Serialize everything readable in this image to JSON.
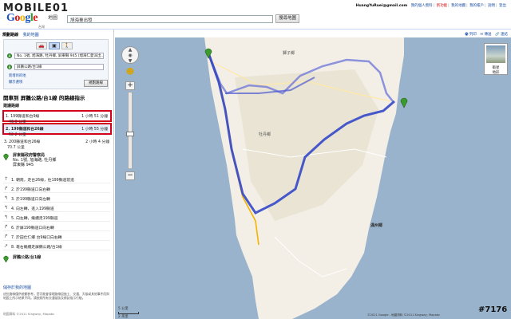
{
  "site": {
    "logo": "MOBILE01"
  },
  "toplinks": {
    "user": "HuangYuRuei@gmail.com",
    "items": [
      "我的個人資料",
      "新功能",
      "我的地圖",
      "我的帳戶",
      "說明",
      "登出"
    ]
  },
  "google": {
    "logo": "Google",
    "product": "地圖",
    "region": "台灣"
  },
  "search": {
    "value": "旭海臺出發",
    "button": "搜尋地圖"
  },
  "map_tools": {
    "items": [
      "列印",
      "傳送",
      "連結"
    ]
  },
  "sidebar": {
    "tabs": {
      "active": "規劃路線",
      "link": "我的地圖"
    },
    "start": {
      "marker": "A",
      "value": "No. 1號, 旭海路, 牡丹鄉, 屏東縣 945 (旭海仁愛派出…"
    },
    "end": {
      "marker": "B",
      "value": "屏鵝公路/台1線"
    },
    "add_destination": "新增目的地",
    "options": "顯示選項",
    "get_directions": "規劃路線",
    "heading": "開車到 屏鵝公路/台1線 的路線指示",
    "suggest_label": "建議路線",
    "routes": [
      {
        "name": "1. 199縣道和台9線",
        "time": "1 小時 51 分鐘",
        "dist": "46.0 公里"
      },
      {
        "name": "2. 199縣道和台26線",
        "time": "1 小時 55 分鐘",
        "dist": "52.2 公里"
      },
      {
        "name": "3. 200縣道和台26線",
        "time": "2 小時 4 分鐘",
        "dist": "70.7 公里"
      }
    ],
    "origin": {
      "title": "屏東縣政府警察局",
      "line2": "No. 1號, 旭海路, 牡丹鄉",
      "line3": "屏東縣 945"
    },
    "steps": [
      {
        "text": "1. 朝南，走台26線，往199縣道前進",
        "dist": ""
      },
      {
        "text": "2. 於199縣道口向右轉",
        "dist": ""
      },
      {
        "text": "3. 於199縣道口向左轉",
        "dist": ""
      },
      {
        "text": "4. 向左轉，進入199縣道",
        "dist": ""
      },
      {
        "text": "5. 向左轉，繼續走199縣道",
        "dist": ""
      },
      {
        "text": "6. 於屏199縣道口向右轉",
        "dist": ""
      },
      {
        "text": "7. 於田仕仁鄉 台9線口向右轉",
        "dist": ""
      },
      {
        "text": "8. 靠右繼續走屏鵝公路/台1線",
        "dist": ""
      }
    ],
    "destination": {
      "title": "屏鵝公路/台1線"
    },
    "save_link": "儲存於我的地圖",
    "disclaimer": "這些路線僅供規劃參考。您可能會發現路線因施工、交通、天候或其他事件而與地圖上所示結果不同。請依照所有交通號誌及標誌指示行駛。",
    "copyright": "地圖資料 ©2011 Kingway, Mapabc"
  },
  "map": {
    "layer": {
      "label": "衛星",
      "label2": "地形"
    },
    "labels": [
      "獅子鄉",
      "牡丹鄉",
      "滿州鄉"
    ],
    "scale": "5 公里",
    "scale2": "2 英里",
    "copyright": "©2011 Google - 地圖資料 ©2011 Kingway, Mapabc",
    "watermark": "#7176"
  }
}
